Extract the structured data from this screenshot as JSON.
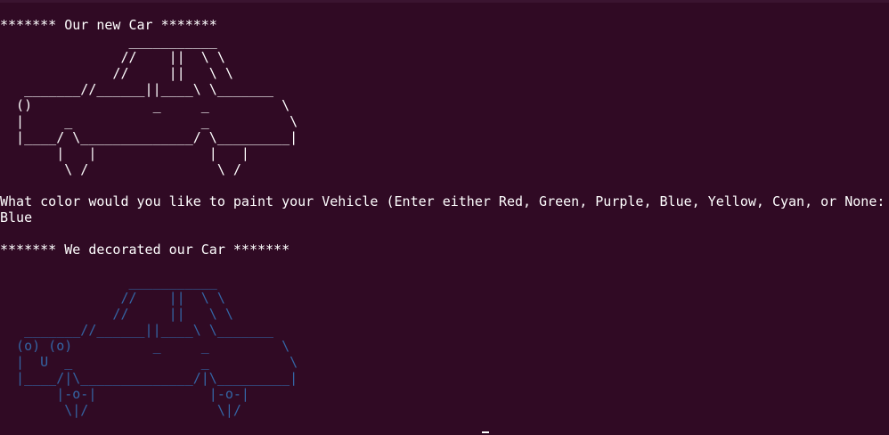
{
  "colors": {
    "background": "#300a24",
    "text": "#ffffff",
    "decorated_car": "#3465a4"
  },
  "terminal": {
    "header1": "******* Our new Car *******",
    "car_art_plain": "                ___________\n               //    ||  \\ \\\n              //     ||   \\ \\\n   _______//______||____\\ \\_______\n  ()               _     _         \\\n  |     _                _          \\\n  |____/ \\______________/ \\_________|\n       |   |              |   |\n        \\ /                \\ /",
    "prompt": "What color would you like to paint your Vehicle (Enter either Red, Green, Purple, Blue, Yellow, Cyan, or None:",
    "answer": "Blue",
    "header2": "******* We decorated our Car *******",
    "car_art_decorated": "                ___________\n               //    ||  \\ \\\n              //     ||   \\ \\\n   _______//______||____\\ \\_______\n  (o) (o)          _     _         \\\n  |  U  _                _          \\\n  |____/|\\______________/|\\_________|\n       |-o-|              |-o-|\n        \\|/                \\|/"
  }
}
